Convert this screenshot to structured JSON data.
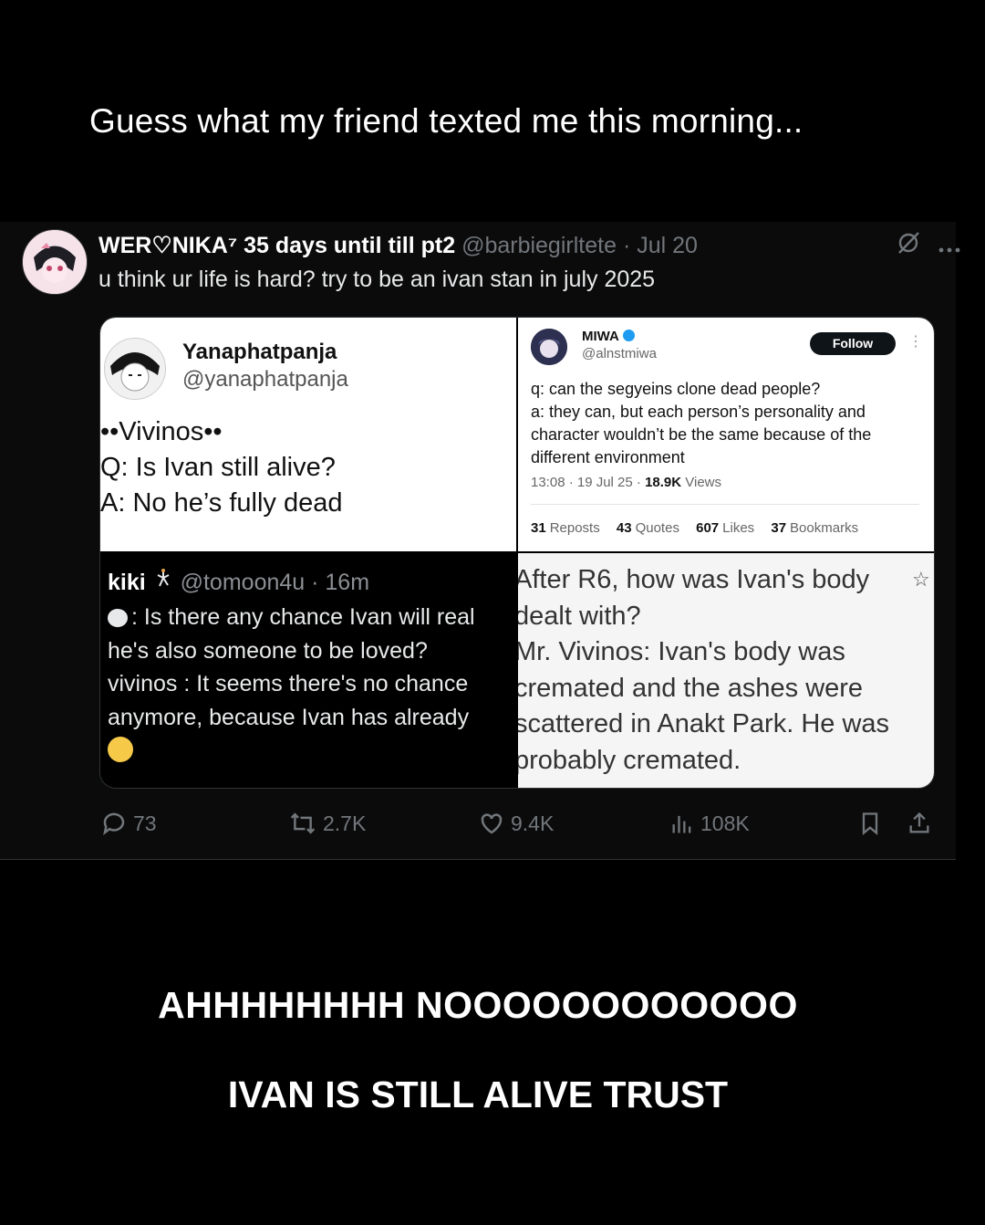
{
  "captions": {
    "top": "Guess what my friend texted me this morning...",
    "shout": "AHHHHHHHH NOOOOOOOOOOOO",
    "claim": "IVAN IS STILL ALIVE TRUST"
  },
  "tweet": {
    "author_name": "WER♡NIKA⁷ 35 days until till pt2",
    "handle": "@barbiegirltete",
    "date": "· Jul 20",
    "text": "u think ur life is hard? try to be an ivan stan in july 2025",
    "more_icon": "more-icon",
    "grok_icon": "grok-icon"
  },
  "panel1": {
    "name": "Yanaphatpanja",
    "handle": "@yanaphatpanja",
    "lines": [
      "••Vivinos••",
      "Q: Is Ivan still alive?",
      "A: No he’s fully dead"
    ]
  },
  "panel2": {
    "name": "MIWA",
    "handle": "@alnstmiwa",
    "follow_label": "Follow",
    "more": "⋮",
    "body": [
      "q: can the segyeins clone dead people?",
      "a: they can, but each person’s personality and",
      "character wouldn’t be the same because of the",
      "different environment"
    ],
    "time": "13:08 · 19 Jul 25 · ",
    "views_count": "18.9K",
    "views_label": " Views",
    "stats": [
      {
        "count": "31",
        "label": "Reposts"
      },
      {
        "count": "43",
        "label": "Quotes"
      },
      {
        "count": "607",
        "label": "Likes"
      },
      {
        "count": "37",
        "label": "Bookmarks"
      }
    ]
  },
  "panel3": {
    "name": "kiki",
    "handle": "@tomoon4u · 16m",
    "lines": [
      ": Is there any chance Ivan will real",
      "he's also someone to be loved?",
      "vivinos : It seems there's no chance",
      "anymore, because Ivan has already"
    ]
  },
  "panel4": {
    "lines": [
      "After R6, how was Ivan's body",
      "dealt with?",
      "Mr. Vivinos: Ivan's body was",
      "cremated and the ashes were",
      "scattered in Anakt Park. He was",
      "probably cremated."
    ],
    "star": "☆"
  },
  "actions": {
    "replies": "73",
    "reposts": "2.7K",
    "likes": "9.4K",
    "views": "108K"
  }
}
